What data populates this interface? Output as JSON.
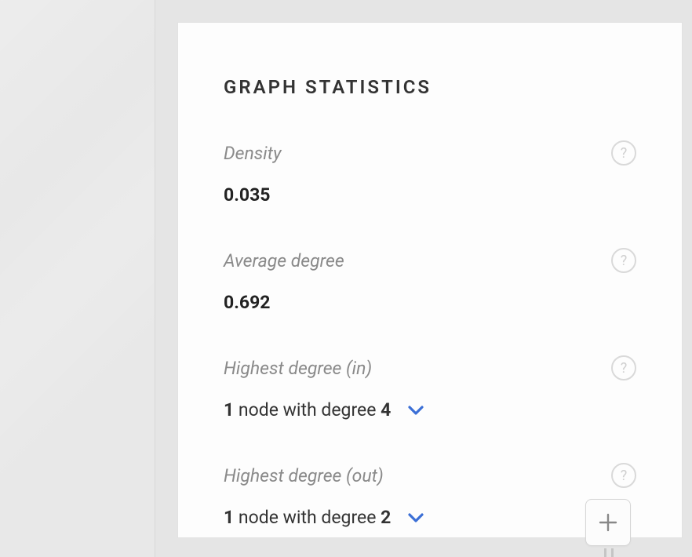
{
  "panel": {
    "title": "GRAPH STATISTICS",
    "stats": {
      "density": {
        "label": "Density",
        "value": "0.035"
      },
      "avg_degree": {
        "label": "Average degree",
        "value": "0.692"
      },
      "highest_in": {
        "label": "Highest degree (in)",
        "count": "1",
        "mid": " node with degree ",
        "degree": "4"
      },
      "highest_out": {
        "label": "Highest degree (out)",
        "count": "1",
        "mid": " node with degree ",
        "degree": "2"
      }
    }
  },
  "icons": {
    "help": "?"
  }
}
